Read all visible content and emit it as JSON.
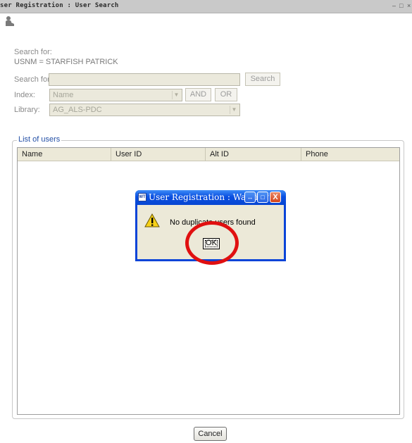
{
  "window": {
    "title": "ser Registration : User Search",
    "controls": [
      "–",
      "□",
      "×"
    ]
  },
  "search_context": {
    "heading": "Search for:",
    "value": "USNM = STARFISH PATRICK"
  },
  "form": {
    "search_label": "Search for:",
    "search_value": "",
    "search_button": "Search",
    "index_label": "Index:",
    "index_value": "Name",
    "and_button": "AND",
    "or_button": "OR",
    "library_label": "Library:",
    "library_value": "AG_ALS-PDC"
  },
  "users_group": {
    "legend": "List of users",
    "columns": [
      "Name",
      "User ID",
      "Alt ID",
      "Phone"
    ]
  },
  "dialog": {
    "title": "User Registration : Warning",
    "app_icon": "WT",
    "message": "No duplicate users found",
    "ok_label": "OK",
    "title_buttons": [
      "↔",
      "□",
      "X"
    ]
  },
  "annotation": {
    "color": "#e01010"
  },
  "footer": {
    "cancel_label": "Cancel"
  },
  "colors": {
    "dialog_border": "#0a44d8",
    "titlebar": "#c9c9c9",
    "legend": "#2450a6"
  }
}
